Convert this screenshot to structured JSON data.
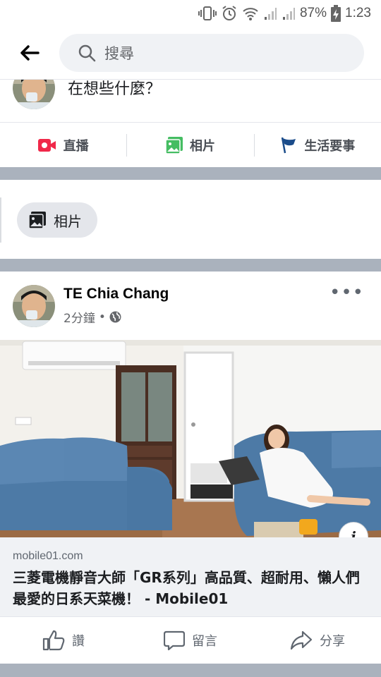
{
  "status_bar": {
    "battery": "87%",
    "time": "1:23",
    "icons": [
      "vibrate-icon",
      "alarm-icon",
      "wifi-icon",
      "signal-icon-1",
      "signal-icon-2",
      "battery-charging-icon"
    ]
  },
  "header": {
    "back_icon": "back-arrow-icon",
    "search_placeholder": "搜尋"
  },
  "composer": {
    "prompt": "在想些什麼？",
    "actions": [
      {
        "label": "直播",
        "icon": "live-video-icon",
        "color": "#f02849"
      },
      {
        "label": "相片",
        "icon": "photo-icon",
        "color": "#45bd62"
      },
      {
        "label": "生活要事",
        "icon": "flag-icon",
        "color": "#1b4c8a"
      }
    ]
  },
  "photo_chip": {
    "label": "相片",
    "icon": "photo-icon"
  },
  "post": {
    "author": "TE Chia Chang",
    "time": "2分鐘",
    "separator": "•",
    "privacy_icon": "globe-icon",
    "more_label": "•••",
    "link": {
      "domain": "mobile01.com",
      "title": "三菱電機靜音大師「GR系列」高品質、超耐用、懶人們最愛的日系天菜機！ - Mobile01"
    },
    "info_label": "i",
    "actions": [
      {
        "label": "讚",
        "icon": "like-icon"
      },
      {
        "label": "留言",
        "icon": "comment-icon"
      },
      {
        "label": "分享",
        "icon": "share-icon"
      }
    ]
  },
  "colors": {
    "divider": "#aab2bd",
    "search_bg": "#f0f2f5",
    "link_bg": "#f0f2f5"
  }
}
